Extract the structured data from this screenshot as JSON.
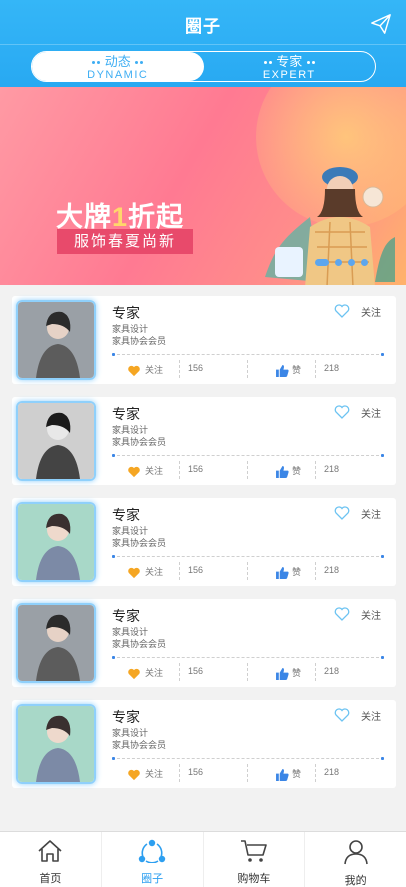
{
  "header": {
    "title": "圈子"
  },
  "segment": {
    "tabs": [
      {
        "cn": "动态",
        "en": "DYNAMIC",
        "active": true
      },
      {
        "cn": "专家",
        "en": "EXPERT",
        "active": false
      }
    ]
  },
  "banner": {
    "headline_pre": "大牌",
    "headline_num": "1",
    "headline_post": "折起",
    "tagline": "服饰春夏尚新",
    "dots": 4,
    "active_dot": 0
  },
  "cards": [
    {
      "title": "专家",
      "line1": "家具设计",
      "line2": "家具协会会员",
      "follow": "关注",
      "follow_count": "156",
      "like": "赞",
      "like_count": "218",
      "top_action": "关注"
    },
    {
      "title": "专家",
      "line1": "家具设计",
      "line2": "家具协会会员",
      "follow": "关注",
      "follow_count": "156",
      "like": "赞",
      "like_count": "218",
      "top_action": "关注"
    },
    {
      "title": "专家",
      "line1": "家具设计",
      "line2": "家具协会会员",
      "follow": "关注",
      "follow_count": "156",
      "like": "赞",
      "like_count": "218",
      "top_action": "关注"
    },
    {
      "title": "专家",
      "line1": "家具设计",
      "line2": "家具协会会员",
      "follow": "关注",
      "follow_count": "156",
      "like": "赞",
      "like_count": "218",
      "top_action": "关注"
    },
    {
      "title": "专家",
      "line1": "家具设计",
      "line2": "家具协会会员",
      "follow": "关注",
      "follow_count": "156",
      "like": "赞",
      "like_count": "218",
      "top_action": "关注"
    }
  ],
  "tabbar": {
    "items": [
      {
        "label": "首页",
        "icon": "home-icon",
        "active": false
      },
      {
        "label": "圈子",
        "icon": "circle-share-icon",
        "active": true
      },
      {
        "label": "购物车",
        "icon": "cart-icon",
        "active": false
      },
      {
        "label": "我的",
        "icon": "user-icon",
        "active": false
      }
    ]
  },
  "colors": {
    "primary": "#2d9ff0",
    "header": "#35b6f7",
    "accent_follow": "#f5a623",
    "accent_like": "#3b86e6"
  }
}
